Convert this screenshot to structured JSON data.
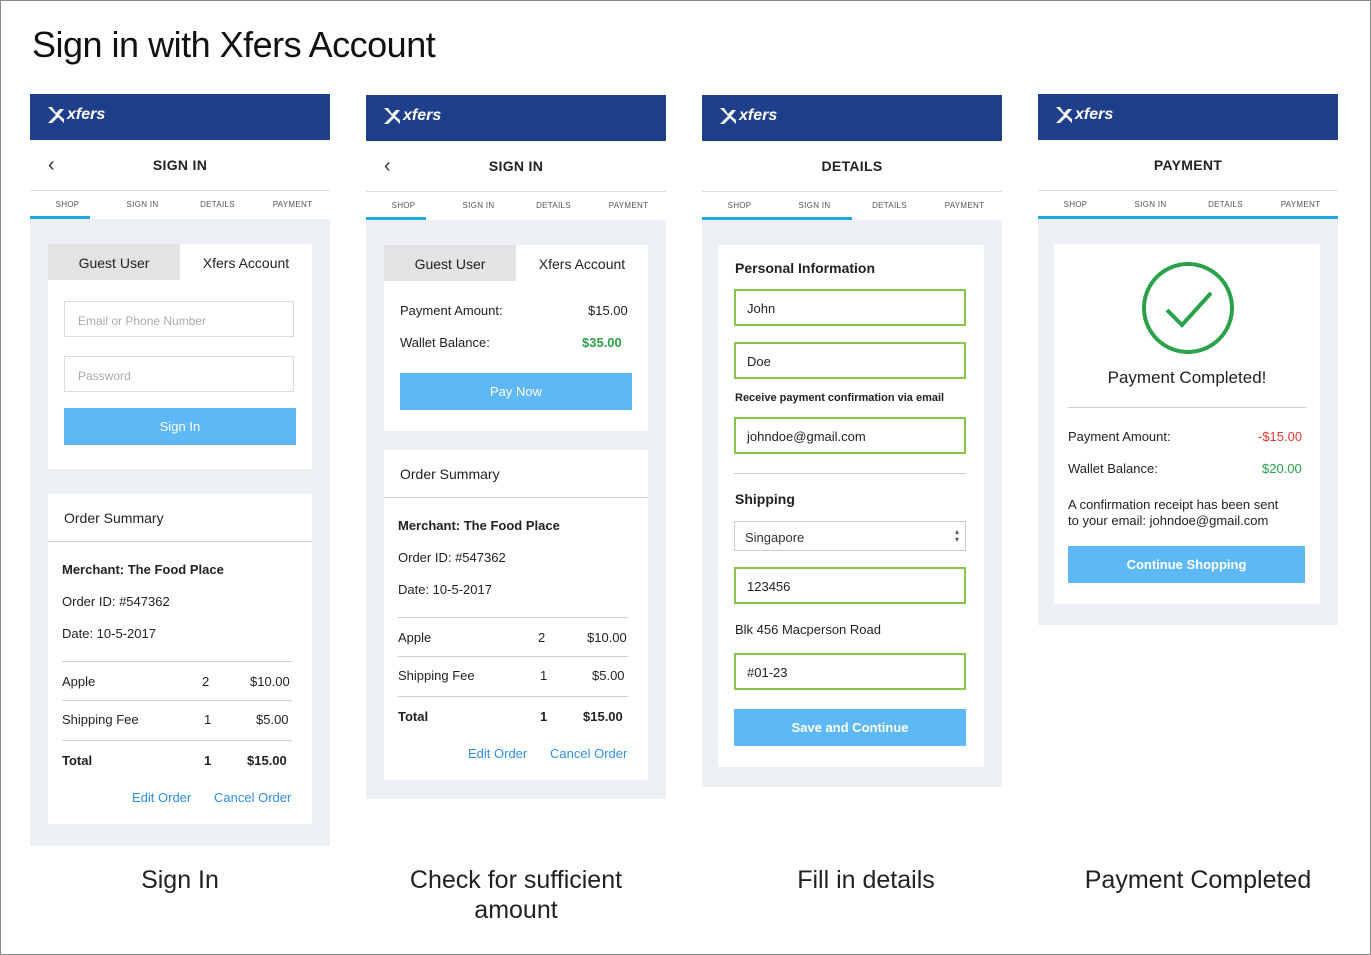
{
  "page_title": "Sign in with Xfers Account",
  "brand": "xfers",
  "steps": [
    "SHOP",
    "SIGN IN",
    "DETAILS",
    "PAYMENT"
  ],
  "colors": {
    "brand_bar": "#1f3f8a",
    "button": "#5db8f5",
    "accent_underline": "#1fa8e0",
    "success_green": "#2aa14a",
    "error_red": "#e53935",
    "input_valid_border": "#8bc34a"
  },
  "screen1": {
    "title": "SIGN IN",
    "tabs": [
      "Guest User",
      "Xfers Account"
    ],
    "email_placeholder": "Email or Phone Number",
    "password_placeholder": "Password",
    "sign_in_button": "Sign In",
    "caption": "Sign In"
  },
  "screen2": {
    "title": "SIGN IN",
    "tabs": [
      "Guest User",
      "Xfers Account"
    ],
    "payment_amount_label": "Payment Amount:",
    "payment_amount_value": "$15.00",
    "wallet_balance_label": "Wallet Balance:",
    "wallet_balance_value": "$35.00",
    "pay_now_button": "Pay Now",
    "caption_line1": "Check for sufficient",
    "caption_line2": "amount"
  },
  "order_summary": {
    "heading": "Order Summary",
    "merchant": "Merchant: The Food Place",
    "order_id": "Order ID: #547362",
    "date": "Date: 10-5-2017",
    "items": [
      {
        "name": "Apple",
        "qty": "2",
        "price": "$10.00"
      },
      {
        "name": "Shipping Fee",
        "qty": "1",
        "price": "$5.00"
      }
    ],
    "total_label": "Total",
    "total_qty": "1",
    "total_price": "$15.00",
    "edit_link": "Edit Order",
    "cancel_link": "Cancel Order"
  },
  "screen3": {
    "title": "DETAILS",
    "personal_heading": "Personal Information",
    "first_name": "John",
    "last_name": "Doe",
    "email_label": "Receive payment confirmation via email",
    "email": "johndoe@gmail.com",
    "shipping_heading": "Shipping",
    "country": "Singapore",
    "postal_code": "123456",
    "address": "Blk 456 Macperson Road",
    "unit": "#01-23",
    "save_button": "Save and Continue",
    "caption": "Fill in details"
  },
  "screen4": {
    "title": "PAYMENT",
    "completed_text": "Payment Completed!",
    "payment_amount_label": "Payment Amount:",
    "payment_amount_value": "-$15.00",
    "wallet_balance_label": "Wallet Balance:",
    "wallet_balance_value": "$20.00",
    "receipt_line1": "A confirmation receipt has been sent",
    "receipt_line2": "to your email: johndoe@gmail.com",
    "continue_button": "Continue Shopping",
    "caption": "Payment Completed"
  }
}
